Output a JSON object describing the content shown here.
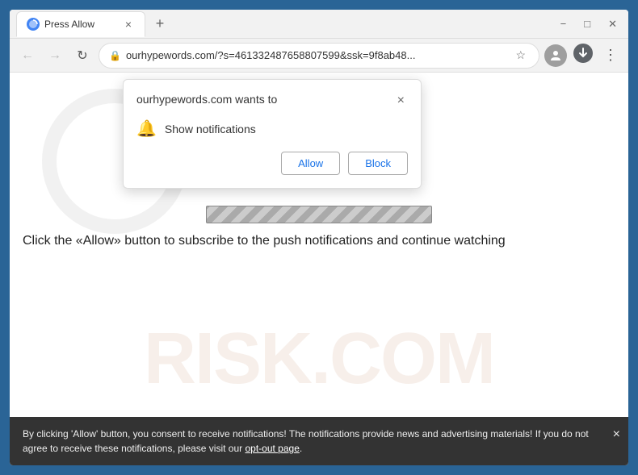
{
  "window": {
    "title": "Press Allow",
    "tab_label": "Press Allow",
    "close_label": "×",
    "minimize_label": "−",
    "maximize_label": "□",
    "close_window_label": "✕"
  },
  "nav": {
    "url": "ourhypewords.com/?s=461332487658807599&ssk=9f8ab48...",
    "url_short": "ourhypewords.com/?s=461332487658807599&ssk=9f8ab48..."
  },
  "popup": {
    "title": "ourhypewords.com wants to",
    "description": "Show notifications",
    "allow_label": "Allow",
    "block_label": "Block",
    "close_label": "×"
  },
  "main_text": "Click the «Allow» button to subscribe to the push notifications and continue watching",
  "consent_bar": {
    "text": "By clicking 'Allow' button, you consent to receive notifications! The notifications provide news and advertising materials! If you do not agree to receive these notifications, please visit our ",
    "link_text": "opt-out page",
    "text_end": ".",
    "close_label": "×"
  },
  "watermark": {
    "text": "risk.com"
  },
  "icons": {
    "tab_favicon": "●",
    "lock": "🔒",
    "star": "☆",
    "profile": "👤",
    "menu": "⋮",
    "bell": "🔔",
    "back": "←",
    "forward": "→",
    "refresh": "↻",
    "download": "⬇"
  }
}
